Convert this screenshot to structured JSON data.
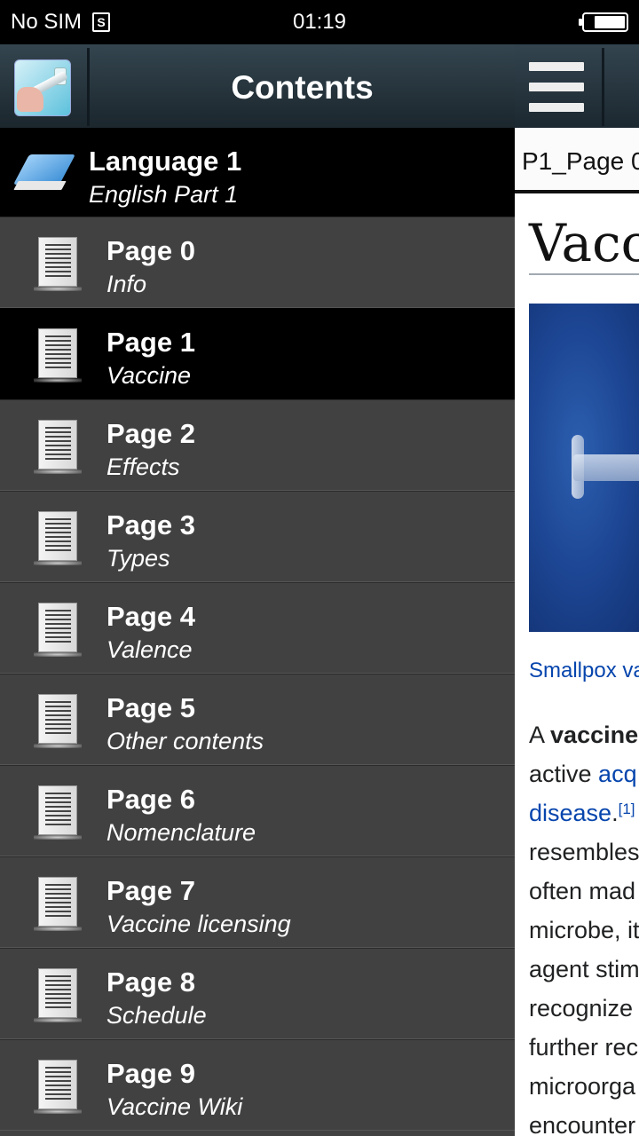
{
  "status_bar": {
    "carrier": "No SIM",
    "sim_glyph": "S",
    "time": "01:19"
  },
  "drawer": {
    "title": "Contents",
    "language": {
      "title": "Language 1",
      "subtitle": "English Part 1"
    },
    "selected_index": 1,
    "pages": [
      {
        "title": "Page 0",
        "subtitle": "Info"
      },
      {
        "title": "Page 1",
        "subtitle": "Vaccine"
      },
      {
        "title": "Page 2",
        "subtitle": "Effects"
      },
      {
        "title": "Page 3",
        "subtitle": "Types"
      },
      {
        "title": "Page 4",
        "subtitle": "Valence"
      },
      {
        "title": "Page 5",
        "subtitle": "Other contents"
      },
      {
        "title": "Page 6",
        "subtitle": "Nomenclature"
      },
      {
        "title": "Page 7",
        "subtitle": "Vaccine licensing"
      },
      {
        "title": "Page 8",
        "subtitle": "Schedule"
      },
      {
        "title": "Page 9",
        "subtitle": "Vaccine Wiki"
      }
    ]
  },
  "content": {
    "tab_label": "P1_Page 0",
    "article_title": "Vacc",
    "image_caption": "Smallpox va",
    "body": {
      "l1_a": "A ",
      "l1_b": "vaccine",
      "l2_a": "active ",
      "l2_b": "acq",
      "l3_a": "disease",
      "l3_b": ".",
      "l3_sup": "[1]",
      "l4": "resembles",
      "l5": "often mad",
      "l6": "microbe, it",
      "l7": "agent stim",
      "l8": "recognize",
      "l9": "further rec",
      "l10": "microorga",
      "l11": "encounter"
    }
  },
  "colors": {
    "header_gradient_top": "#34454f",
    "drawer_bg": "#414141",
    "selected_bg": "#000000",
    "link": "#0645ad"
  }
}
